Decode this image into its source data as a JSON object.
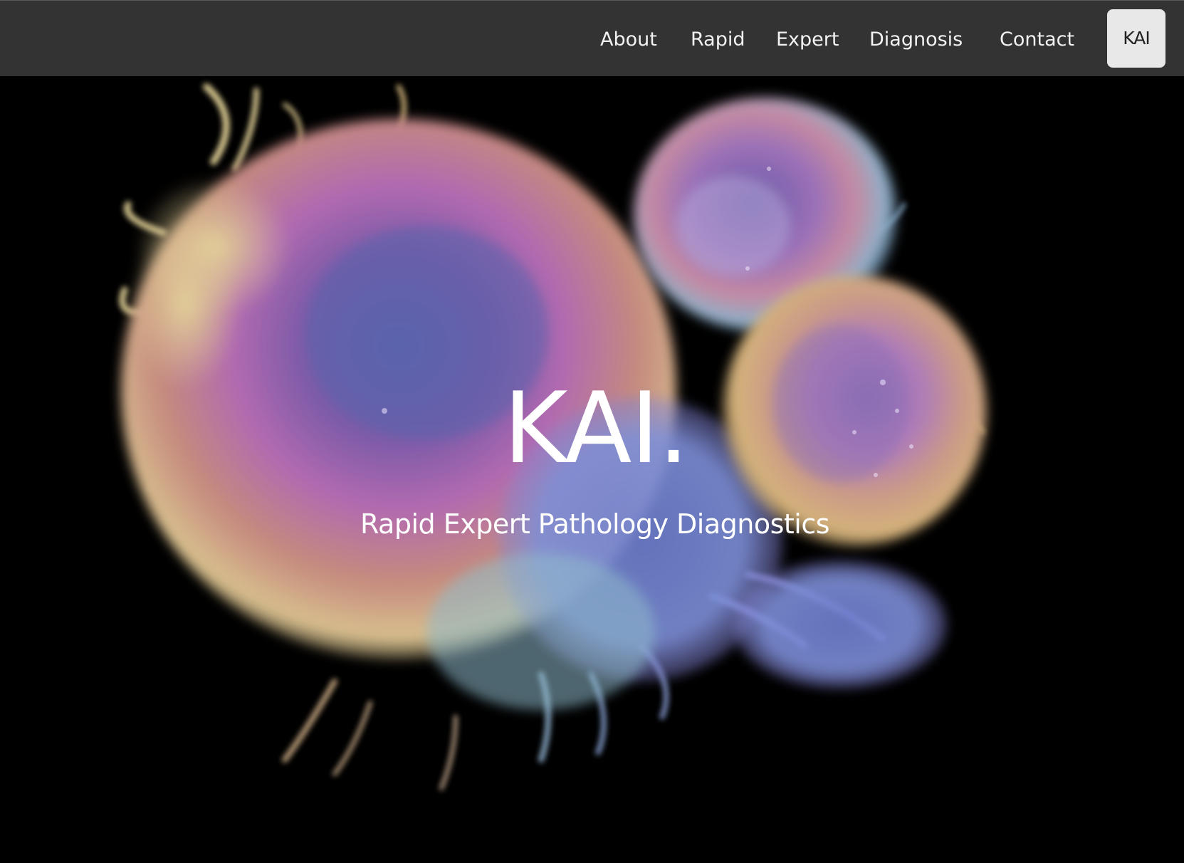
{
  "nav": {
    "items": [
      {
        "label": "About",
        "id": "about"
      },
      {
        "label": "Rapid",
        "id": "rapid"
      },
      {
        "label": "Expert",
        "id": "expert"
      },
      {
        "label": "Diagnosis",
        "id": "diagnosis"
      },
      {
        "label": "Contact",
        "id": "contact"
      }
    ],
    "brand_label": "KAI"
  },
  "hero": {
    "title": "KAI.",
    "subtitle": "Rapid Expert Pathology Diagnostics",
    "image": "colorized electron micrograph of cancer cells"
  },
  "colors": {
    "navbar_bg": "#333333",
    "nav_text": "#f2f2f2",
    "brand_button_bg": "#e8e8e8",
    "page_bg": "#000000"
  }
}
